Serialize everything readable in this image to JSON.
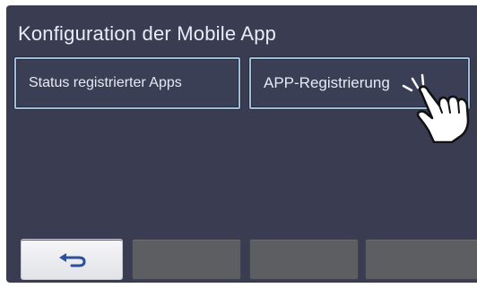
{
  "screen": {
    "title": "Konfiguration der Mobile App"
  },
  "menu": {
    "status_label": "Status registrierter Apps",
    "register_label": "APP-Registrierung"
  },
  "footer": {
    "back_icon": "return-arrow-icon",
    "soft_keys": [
      "",
      "",
      ""
    ]
  },
  "overlay": {
    "cursor_icon": "pointing-hand-icon"
  },
  "colors": {
    "screen_background": "#3a3d52",
    "button_border": "#9fbfd8",
    "soft_key": "#5d5e62",
    "back_key": "#f0f0f3",
    "back_arrow": "#2d4fa0"
  }
}
